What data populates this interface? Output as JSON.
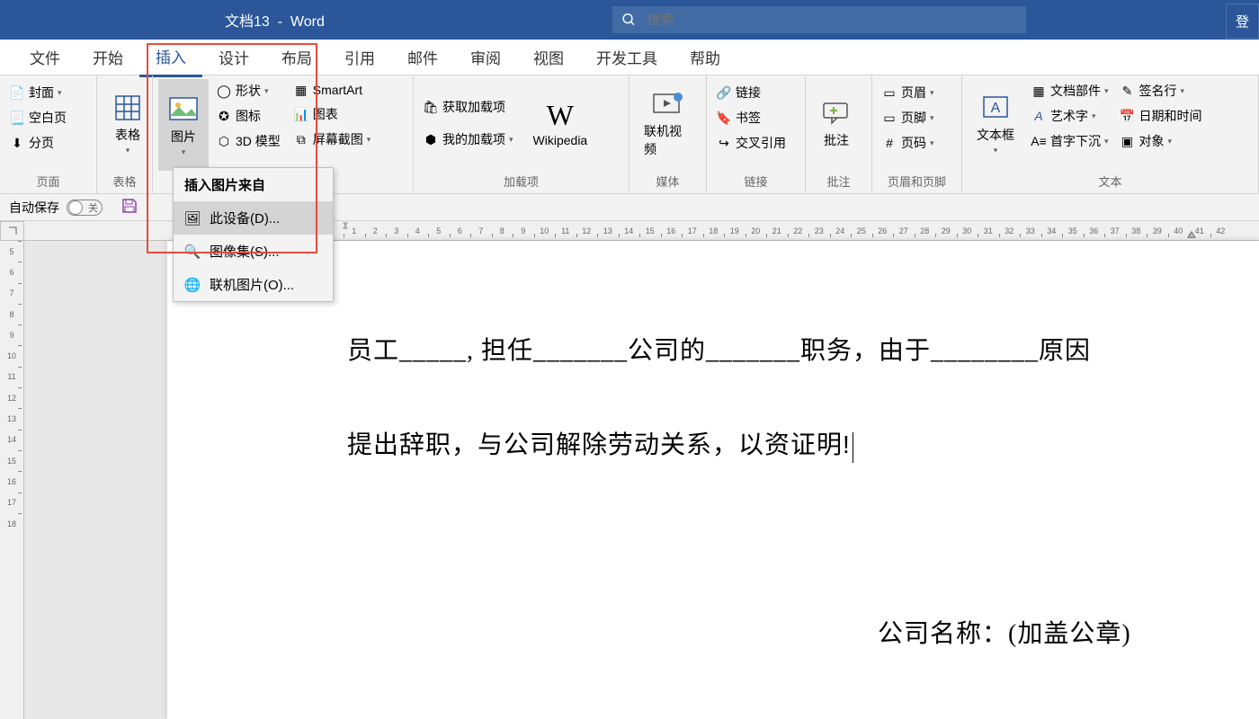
{
  "titlebar": {
    "doc_title": "文档13",
    "app_name": "Word",
    "search_placeholder": "搜索",
    "login": "登"
  },
  "tabs": [
    "文件",
    "开始",
    "插入",
    "设计",
    "布局",
    "引用",
    "邮件",
    "审阅",
    "视图",
    "开发工具",
    "帮助"
  ],
  "active_tab": "插入",
  "ribbon": {
    "pages": {
      "cover": "封面",
      "blank": "空白页",
      "break": "分页",
      "label": "页面"
    },
    "tables": {
      "table": "表格",
      "label": "表格"
    },
    "illustrations": {
      "picture": "图片",
      "shapes": "形状",
      "icons": "图标",
      "model3d": "3D 模型",
      "smartart": "SmartArt",
      "chart": "图表",
      "screenshot": "屏幕截图"
    },
    "addins": {
      "get": "获取加载项",
      "my": "我的加载项",
      "wikipedia": "Wikipedia",
      "label": "加载项"
    },
    "media": {
      "video": "联机视频",
      "label": "媒体"
    },
    "links": {
      "link": "链接",
      "bookmark": "书签",
      "crossref": "交叉引用",
      "label": "链接"
    },
    "comments": {
      "comment": "批注",
      "label": "批注"
    },
    "headerfooter": {
      "header": "页眉",
      "footer": "页脚",
      "number": "页码",
      "label": "页眉和页脚"
    },
    "text": {
      "textbox": "文本框",
      "parts": "文档部件",
      "wordart": "艺术字",
      "dropcap": "首字下沉",
      "sigline": "签名行",
      "datetime": "日期和时间",
      "object": "对象",
      "label": "文本"
    }
  },
  "picture_dropdown": {
    "header": "插入图片来自",
    "items": [
      "此设备(D)...",
      "图像集(S)...",
      "联机图片(O)..."
    ]
  },
  "qat": {
    "autosave": "自动保存",
    "autosave_state": "关"
  },
  "ruler_h": [
    1,
    2,
    3,
    4,
    5,
    6,
    7,
    8,
    9,
    10,
    11,
    12,
    13,
    14,
    15,
    16,
    17,
    18,
    19,
    20,
    21,
    22,
    23,
    24,
    25,
    26,
    27,
    28,
    29,
    30,
    31,
    32,
    33,
    34,
    35,
    36,
    37,
    38,
    39,
    40,
    41,
    42
  ],
  "ruler_v": [
    5,
    6,
    7,
    8,
    9,
    10,
    11,
    12,
    13,
    14,
    15,
    16,
    17,
    18
  ],
  "document": {
    "line1": "员工_____, 担任_______公司的_______职务，由于________原因",
    "line2": "提出辞职，与公司解除劳动关系，以资证明!",
    "line3": "公司名称：(加盖公章)"
  }
}
